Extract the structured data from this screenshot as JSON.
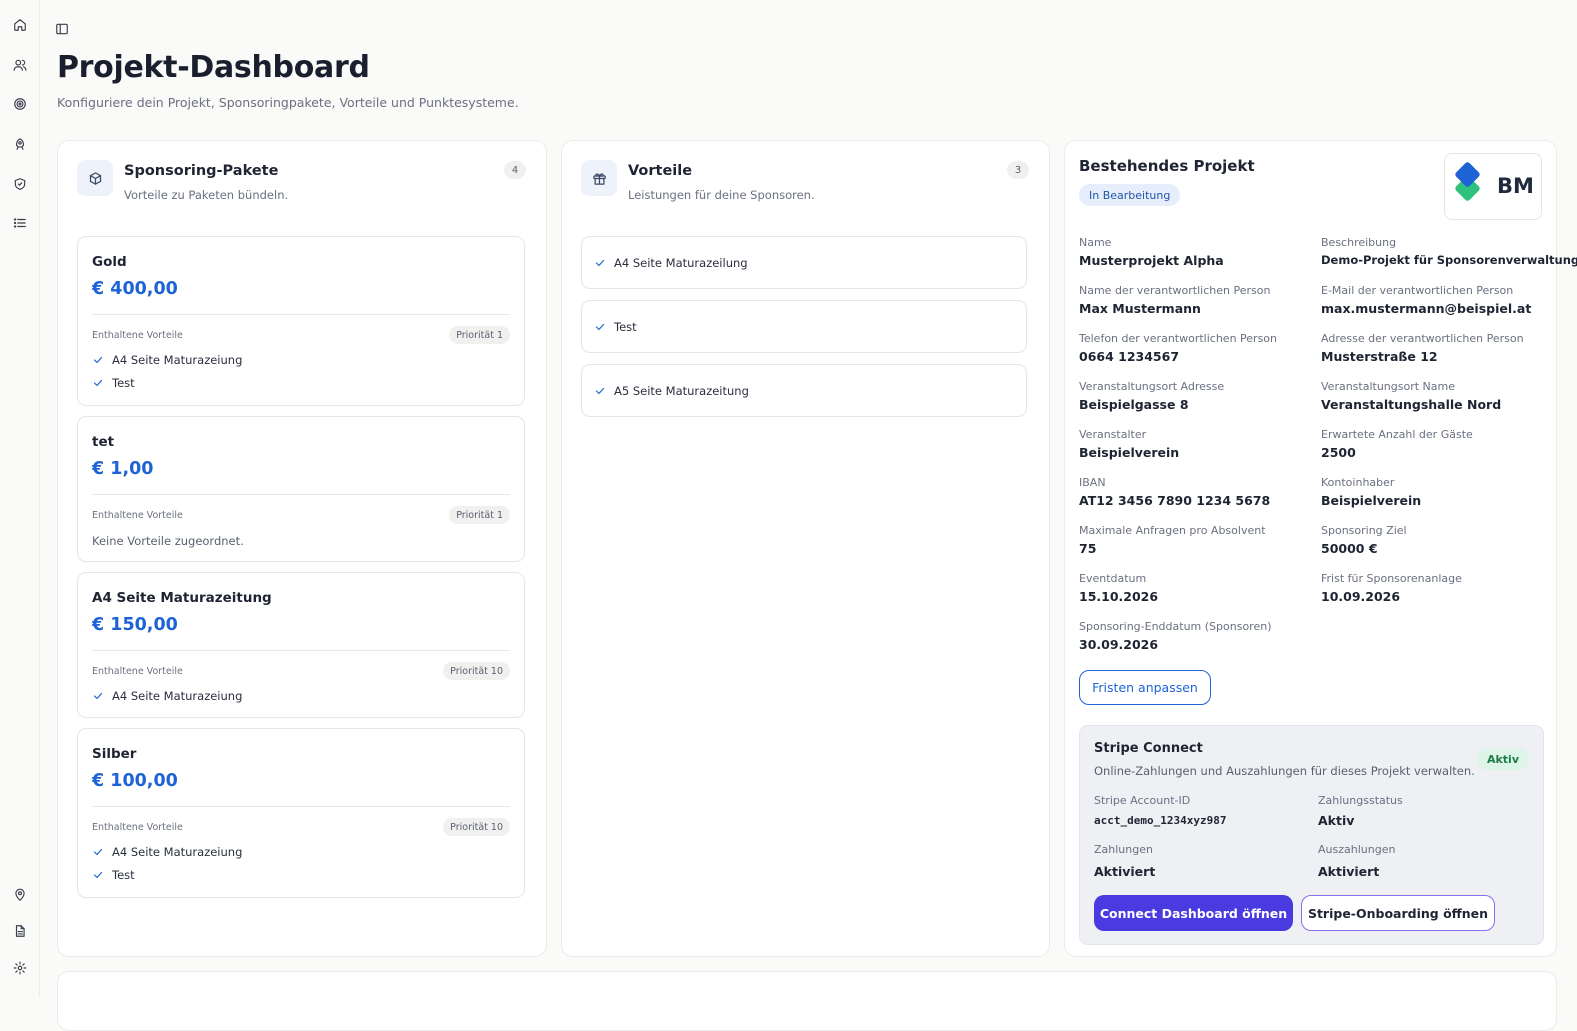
{
  "icons": {
    "sidebar_top": [
      "home-icon",
      "users-icon",
      "target-icon",
      "rocket-icon",
      "shield-icon",
      "list-icon"
    ],
    "sidebar_bottom": [
      "map-pin-icon",
      "document-icon",
      "settings-icon"
    ]
  },
  "header": {
    "title": "Projekt-Dashboard",
    "subtitle": "Konfiguriere dein Projekt, Sponsoringpakete, Vorteile und Punktesysteme."
  },
  "packages_card": {
    "title": "Sponsoring-Pakete",
    "subtitle": "Vorteile zu Paketen bündeln.",
    "count": "4",
    "included_label": "Enthaltene Vorteile",
    "empty_text": "Keine Vorteile zugeordnet.",
    "packages": [
      {
        "name": "Gold",
        "price": "€ 400,00",
        "priority": "Priorität 1",
        "items": [
          "A4 Seite Maturazeiung",
          "Test"
        ]
      },
      {
        "name": "tet",
        "price": "€ 1,00",
        "priority": "Priorität 1",
        "items": []
      },
      {
        "name": "A4 Seite Maturazeitung",
        "price": "€ 150,00",
        "priority": "Priorität 10",
        "items": [
          "A4 Seite Maturazeiung"
        ]
      },
      {
        "name": "Silber",
        "price": "€ 100,00",
        "priority": "Priorität 10",
        "items": [
          "A4 Seite Maturazeiung",
          "Test"
        ]
      }
    ]
  },
  "advantages_card": {
    "title": "Vorteile",
    "subtitle": "Leistungen für deine Sponsoren.",
    "count": "3",
    "items": [
      "A4 Seite Maturazeilung",
      "Test",
      "A5 Seite Maturazeitung"
    ]
  },
  "project_card": {
    "title": "Bestehendes Projekt",
    "status": "In Bearbeitung",
    "logo_text": "BM",
    "fields": [
      {
        "label": "Name",
        "value": "Musterprojekt Alpha"
      },
      {
        "label": "Beschreibung",
        "value": "Demo-Projekt für Sponsorenverwaltung"
      },
      {
        "label": "Name der verantwortlichen Person",
        "value": "Max Mustermann"
      },
      {
        "label": "E-Mail der verantwortlichen Person",
        "value": "max.mustermann@beispiel.at"
      },
      {
        "label": "Telefon der verantwortlichen Person",
        "value": "0664 1234567"
      },
      {
        "label": "Adresse der verantwortlichen Person",
        "value": "Musterstraße 12"
      },
      {
        "label": "Veranstaltungsort Adresse",
        "value": "Beispielgasse 8"
      },
      {
        "label": "Veranstaltungsort Name",
        "value": "Veranstaltungshalle Nord"
      },
      {
        "label": "Veranstalter",
        "value": "Beispielverein"
      },
      {
        "label": "Erwartete Anzahl der Gäste",
        "value": "2500"
      },
      {
        "label": "IBAN",
        "value": "AT12 3456 7890 1234 5678"
      },
      {
        "label": "Kontoinhaber",
        "value": "Beispielverein"
      },
      {
        "label": "Maximale Anfragen pro Absolvent",
        "value": "75"
      },
      {
        "label": "Sponsoring Ziel",
        "value": "50000 €"
      },
      {
        "label": "Eventdatum",
        "value": "15.10.2026"
      },
      {
        "label": "Frist für Sponsorenanlage",
        "value": "10.09.2026"
      },
      {
        "label": "Sponsoring-Enddatum (Sponsoren)",
        "value": "30.09.2026"
      }
    ],
    "adjust_button": "Fristen anpassen",
    "stripe": {
      "title": "Stripe Connect",
      "subtitle": "Online-Zahlungen und Auszahlungen für dieses Projekt verwalten.",
      "status": "Aktiv",
      "account_label": "Stripe Account-ID",
      "account_value": "acct_demo_1234xyz987",
      "payment_status_label": "Zahlungsstatus",
      "payment_status_value": "Aktiv",
      "payments_label": "Zahlungen",
      "payments_value": "Aktiviert",
      "payouts_label": "Auszahlungen",
      "payouts_value": "Aktiviert",
      "dashboard_button": "Connect Dashboard öffnen",
      "onboarding_button": "Stripe-Onboarding öffnen"
    }
  },
  "colors": {
    "accent_blue": "#1e63d6",
    "primary_purple": "#4a3be0",
    "status_green": "#1d7a4a"
  }
}
